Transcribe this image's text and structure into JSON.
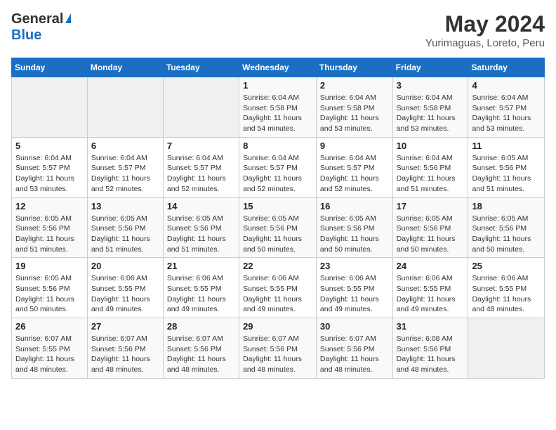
{
  "header": {
    "logo_general": "General",
    "logo_blue": "Blue",
    "month_title": "May 2024",
    "location": "Yurimaguas, Loreto, Peru"
  },
  "days_of_week": [
    "Sunday",
    "Monday",
    "Tuesday",
    "Wednesday",
    "Thursday",
    "Friday",
    "Saturday"
  ],
  "weeks": [
    [
      {
        "day": "",
        "info": ""
      },
      {
        "day": "",
        "info": ""
      },
      {
        "day": "",
        "info": ""
      },
      {
        "day": "1",
        "info": "Sunrise: 6:04 AM\nSunset: 5:58 PM\nDaylight: 11 hours and 54 minutes."
      },
      {
        "day": "2",
        "info": "Sunrise: 6:04 AM\nSunset: 5:58 PM\nDaylight: 11 hours and 53 minutes."
      },
      {
        "day": "3",
        "info": "Sunrise: 6:04 AM\nSunset: 5:58 PM\nDaylight: 11 hours and 53 minutes."
      },
      {
        "day": "4",
        "info": "Sunrise: 6:04 AM\nSunset: 5:57 PM\nDaylight: 11 hours and 53 minutes."
      }
    ],
    [
      {
        "day": "5",
        "info": "Sunrise: 6:04 AM\nSunset: 5:57 PM\nDaylight: 11 hours and 53 minutes."
      },
      {
        "day": "6",
        "info": "Sunrise: 6:04 AM\nSunset: 5:57 PM\nDaylight: 11 hours and 52 minutes."
      },
      {
        "day": "7",
        "info": "Sunrise: 6:04 AM\nSunset: 5:57 PM\nDaylight: 11 hours and 52 minutes."
      },
      {
        "day": "8",
        "info": "Sunrise: 6:04 AM\nSunset: 5:57 PM\nDaylight: 11 hours and 52 minutes."
      },
      {
        "day": "9",
        "info": "Sunrise: 6:04 AM\nSunset: 5:57 PM\nDaylight: 11 hours and 52 minutes."
      },
      {
        "day": "10",
        "info": "Sunrise: 6:04 AM\nSunset: 5:56 PM\nDaylight: 11 hours and 51 minutes."
      },
      {
        "day": "11",
        "info": "Sunrise: 6:05 AM\nSunset: 5:56 PM\nDaylight: 11 hours and 51 minutes."
      }
    ],
    [
      {
        "day": "12",
        "info": "Sunrise: 6:05 AM\nSunset: 5:56 PM\nDaylight: 11 hours and 51 minutes."
      },
      {
        "day": "13",
        "info": "Sunrise: 6:05 AM\nSunset: 5:56 PM\nDaylight: 11 hours and 51 minutes."
      },
      {
        "day": "14",
        "info": "Sunrise: 6:05 AM\nSunset: 5:56 PM\nDaylight: 11 hours and 51 minutes."
      },
      {
        "day": "15",
        "info": "Sunrise: 6:05 AM\nSunset: 5:56 PM\nDaylight: 11 hours and 50 minutes."
      },
      {
        "day": "16",
        "info": "Sunrise: 6:05 AM\nSunset: 5:56 PM\nDaylight: 11 hours and 50 minutes."
      },
      {
        "day": "17",
        "info": "Sunrise: 6:05 AM\nSunset: 5:56 PM\nDaylight: 11 hours and 50 minutes."
      },
      {
        "day": "18",
        "info": "Sunrise: 6:05 AM\nSunset: 5:56 PM\nDaylight: 11 hours and 50 minutes."
      }
    ],
    [
      {
        "day": "19",
        "info": "Sunrise: 6:05 AM\nSunset: 5:56 PM\nDaylight: 11 hours and 50 minutes."
      },
      {
        "day": "20",
        "info": "Sunrise: 6:06 AM\nSunset: 5:55 PM\nDaylight: 11 hours and 49 minutes."
      },
      {
        "day": "21",
        "info": "Sunrise: 6:06 AM\nSunset: 5:55 PM\nDaylight: 11 hours and 49 minutes."
      },
      {
        "day": "22",
        "info": "Sunrise: 6:06 AM\nSunset: 5:55 PM\nDaylight: 11 hours and 49 minutes."
      },
      {
        "day": "23",
        "info": "Sunrise: 6:06 AM\nSunset: 5:55 PM\nDaylight: 11 hours and 49 minutes."
      },
      {
        "day": "24",
        "info": "Sunrise: 6:06 AM\nSunset: 5:55 PM\nDaylight: 11 hours and 49 minutes."
      },
      {
        "day": "25",
        "info": "Sunrise: 6:06 AM\nSunset: 5:55 PM\nDaylight: 11 hours and 48 minutes."
      }
    ],
    [
      {
        "day": "26",
        "info": "Sunrise: 6:07 AM\nSunset: 5:55 PM\nDaylight: 11 hours and 48 minutes."
      },
      {
        "day": "27",
        "info": "Sunrise: 6:07 AM\nSunset: 5:56 PM\nDaylight: 11 hours and 48 minutes."
      },
      {
        "day": "28",
        "info": "Sunrise: 6:07 AM\nSunset: 5:56 PM\nDaylight: 11 hours and 48 minutes."
      },
      {
        "day": "29",
        "info": "Sunrise: 6:07 AM\nSunset: 5:56 PM\nDaylight: 11 hours and 48 minutes."
      },
      {
        "day": "30",
        "info": "Sunrise: 6:07 AM\nSunset: 5:56 PM\nDaylight: 11 hours and 48 minutes."
      },
      {
        "day": "31",
        "info": "Sunrise: 6:08 AM\nSunset: 5:56 PM\nDaylight: 11 hours and 48 minutes."
      },
      {
        "day": "",
        "info": ""
      }
    ]
  ]
}
